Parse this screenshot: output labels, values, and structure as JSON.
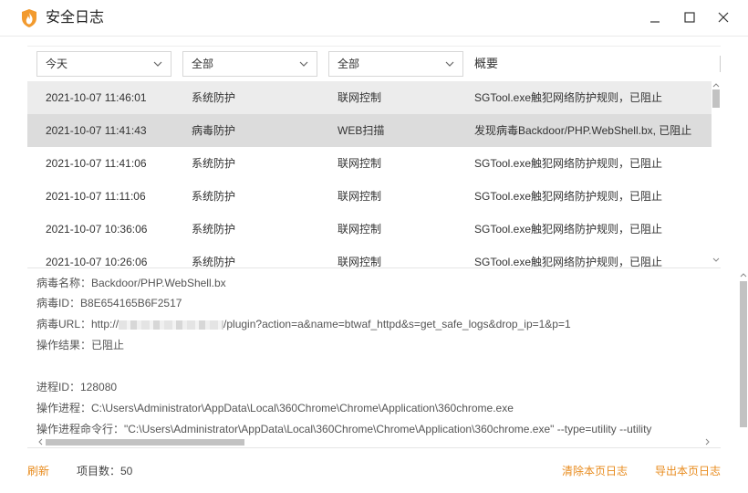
{
  "window": {
    "title": "安全日志"
  },
  "filters": {
    "time": "今天",
    "type": "全部",
    "category": "全部",
    "summary_header": "概要"
  },
  "rows": [
    {
      "time": "2021-10-07 11:46:01",
      "type": "系统防护",
      "category": "联网控制",
      "summary": "SGTool.exe触犯网络防护规则，已阻止"
    },
    {
      "time": "2021-10-07 11:41:43",
      "type": "病毒防护",
      "category": "WEB扫描",
      "summary": "发现病毒Backdoor/PHP.WebShell.bx, 已阻止"
    },
    {
      "time": "2021-10-07 11:41:06",
      "type": "系统防护",
      "category": "联网控制",
      "summary": "SGTool.exe触犯网络防护规则，已阻止"
    },
    {
      "time": "2021-10-07 11:11:06",
      "type": "系统防护",
      "category": "联网控制",
      "summary": "SGTool.exe触犯网络防护规则，已阻止"
    },
    {
      "time": "2021-10-07 10:36:06",
      "type": "系统防护",
      "category": "联网控制",
      "summary": "SGTool.exe触犯网络防护规则，已阻止"
    },
    {
      "time": "2021-10-07 10:26:06",
      "type": "系统防护",
      "category": "联网控制",
      "summary": "SGTool.exe触犯网络防护规则，已阻止"
    }
  ],
  "detail": {
    "virus_name": "病毒名称：Backdoor/PHP.WebShell.bx",
    "virus_id": "病毒ID：B8E654165B6F2517",
    "virus_url_label": "病毒URL：http://",
    "virus_url_rest": "/plugin?action=a&name=btwaf_httpd&s=get_safe_logs&drop_ip=1&p=1",
    "result": "操作结果：已阻止",
    "process_id": "进程ID：128080",
    "process": "操作进程：C:\\Users\\Administrator\\AppData\\Local\\360Chrome\\Chrome\\Application\\360chrome.exe",
    "cmdline": "操作进程命令行：\"C:\\Users\\Administrator\\AppData\\Local\\360Chrome\\Chrome\\Application\\360chrome.exe\" --type=utility --utility"
  },
  "footer": {
    "refresh": "刷新",
    "count": "项目数：50",
    "clear": "清除本页日志",
    "export": "导出本页日志"
  },
  "colors": {
    "accent": "#e88b1d",
    "selected_row": "#dcdcdc",
    "hover_row": "#ececec"
  },
  "icons": {
    "app": "shield-flame-icon",
    "minimize": "minimize-icon",
    "maximize": "maximize-icon",
    "close": "close-icon",
    "dropdown": "chevron-down-icon"
  }
}
